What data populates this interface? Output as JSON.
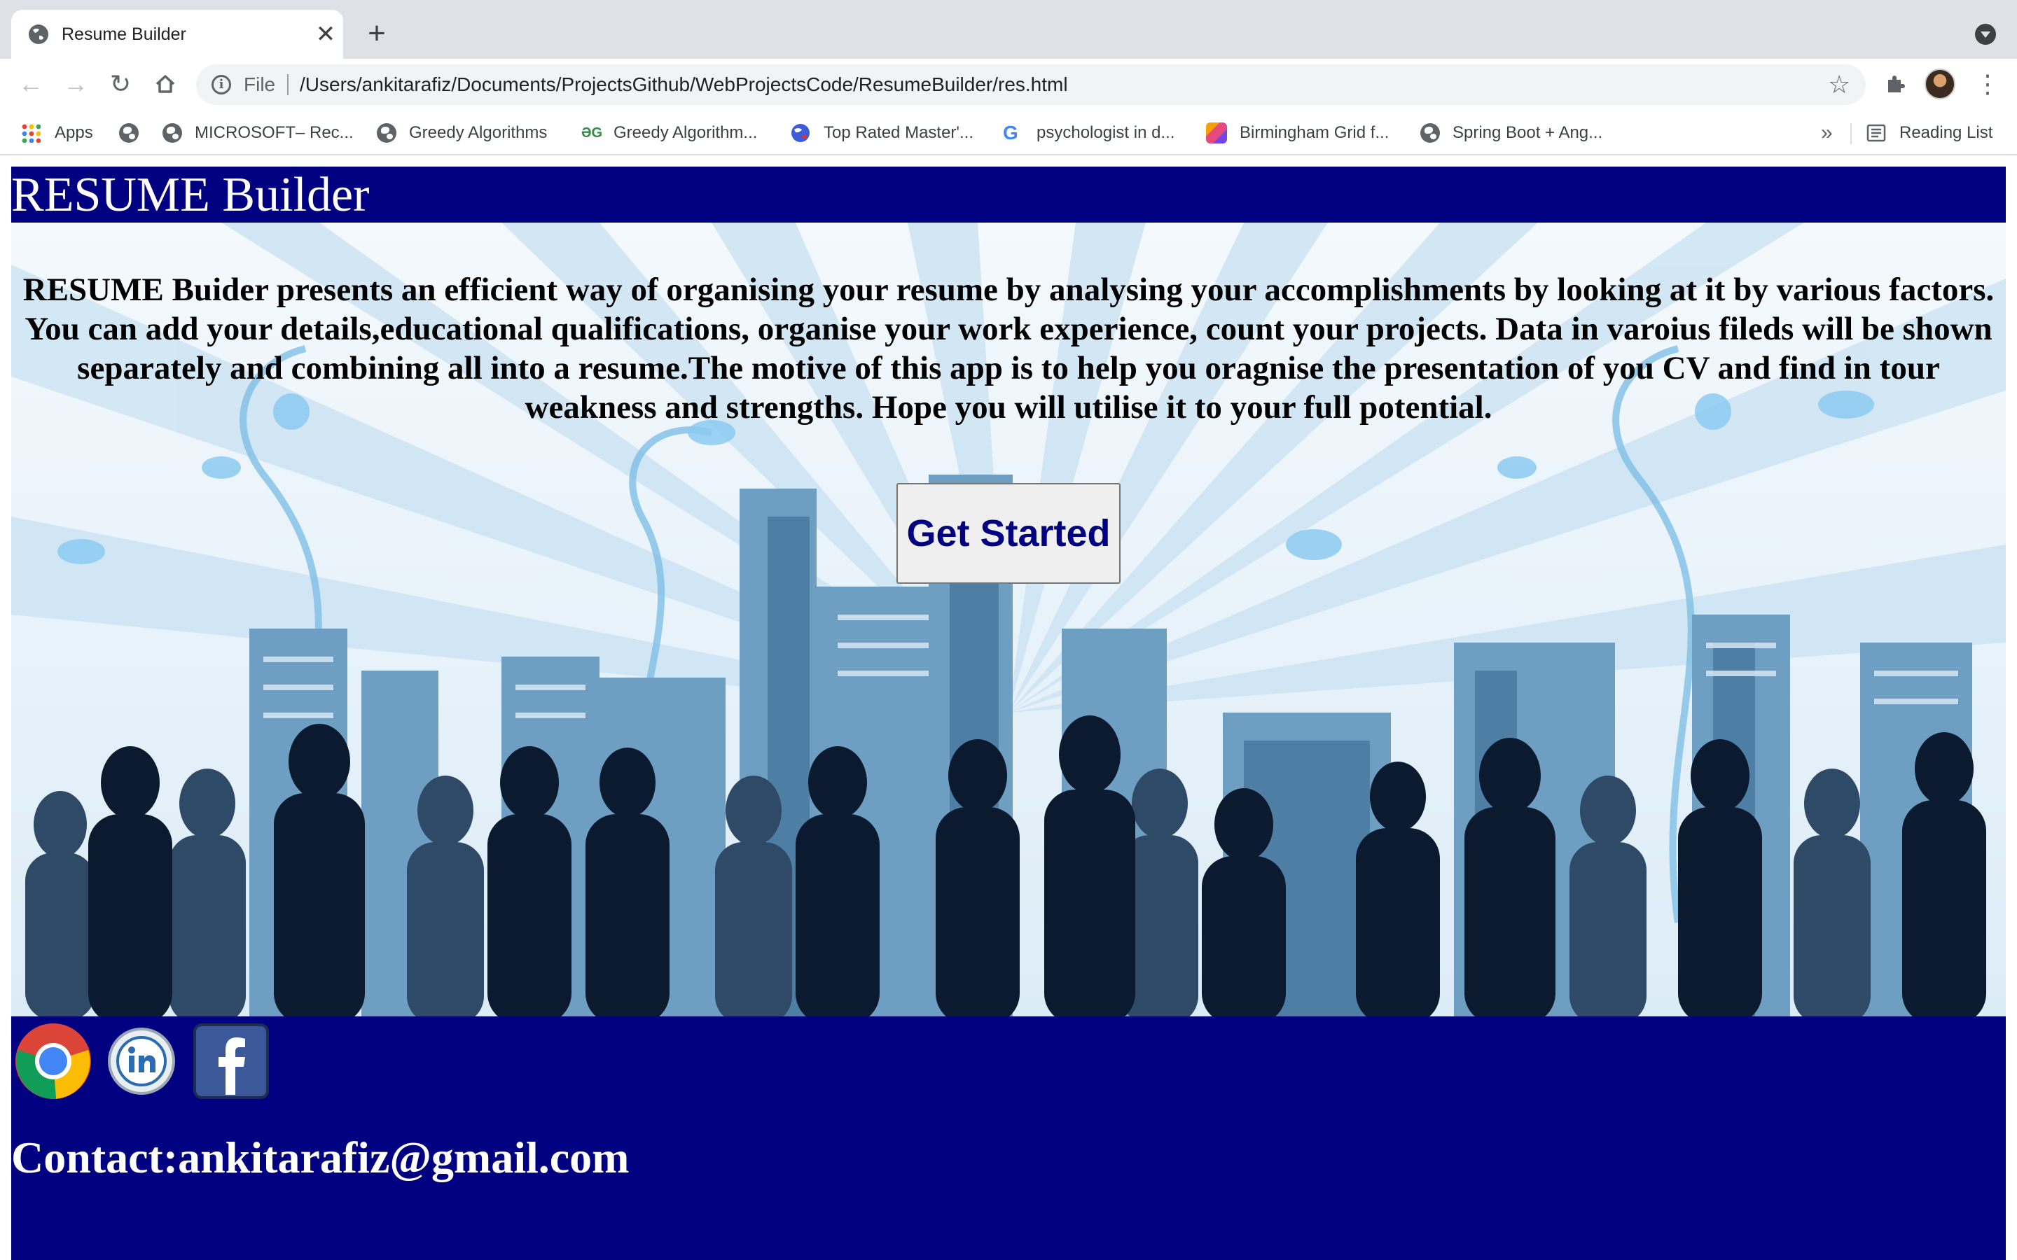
{
  "browser": {
    "tab_title": "Resume Builder",
    "new_tab_symbol": "+",
    "close_symbol": "✕",
    "omnibox": {
      "scheme_label": "File",
      "url": "/Users/ankitarafiz/Documents/ProjectsGithub/WebProjectsCode/ResumeBuilder/res.html"
    },
    "bookmarks": [
      {
        "label": "Apps",
        "icon": "apps-grid-icon"
      },
      {
        "label": "",
        "icon": "globe-icon"
      },
      {
        "label": "MICROSOFT– Rec...",
        "icon": "globe-icon"
      },
      {
        "label": "Greedy Algorithms",
        "icon": "globe-icon"
      },
      {
        "label": "Greedy Algorithm...",
        "icon": "geeksforgeeks-icon"
      },
      {
        "label": "Top Rated Master'...",
        "icon": "upwork-globe-icon"
      },
      {
        "label": "psychologist in d...",
        "icon": "google-icon"
      },
      {
        "label": "Birmingham Grid f...",
        "icon": "colorful-square-icon"
      },
      {
        "label": "Spring Boot + Ang...",
        "icon": "globe-icon"
      }
    ],
    "overflow_symbol": "»",
    "reading_list_label": "Reading List"
  },
  "page": {
    "header_title": "RESUME Builder",
    "intro_text": "RESUME Buider presents an efficient way of organising your resume by analysing your accomplishments by looking at it by various factors. You can add your details,educational qualifications, organise your work experience, count your projects. Data in varoius fileds will be shown separately and combining all into a resume.The motive of this app is to help you oragnise the presentation of you CV and find in tour weakness and strengths. Hope you will utilise it to your full potential.",
    "cta_label": "Get Started",
    "footer": {
      "social_icons": [
        "chrome-icon",
        "linkedin-icon",
        "facebook-icon"
      ],
      "contact_label": "Contact:",
      "contact_email": "ankitarafiz@gmail.com"
    }
  },
  "colors": {
    "navy": "#000080",
    "chrome_bg": "#dee1e6",
    "hero_sky": "#eaf4fb"
  }
}
